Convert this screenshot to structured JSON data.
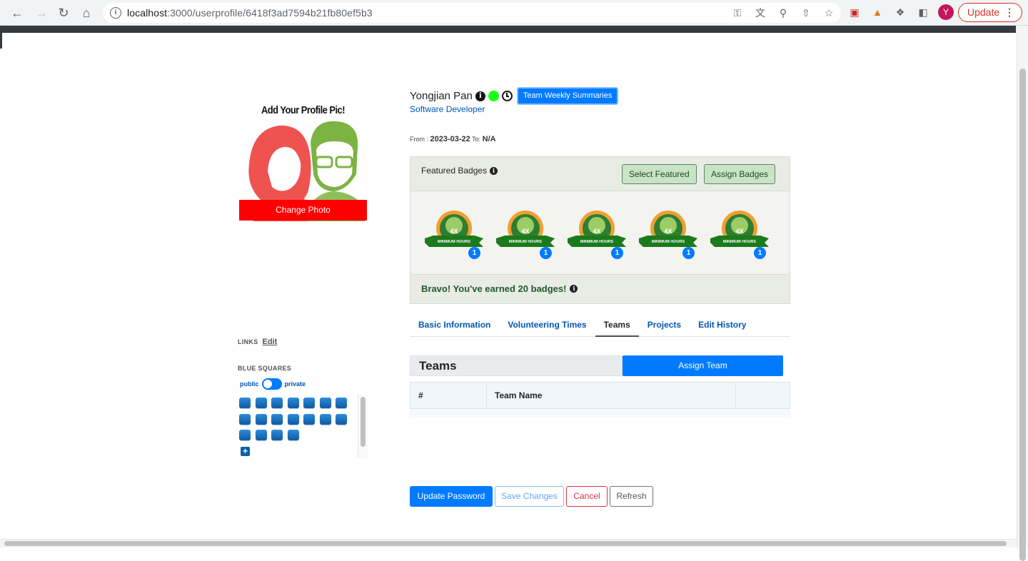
{
  "browser": {
    "url_host": "localhost",
    "url_path": ":3000/userprofile/6418f3ad7594b21fb80ef5b3",
    "avatar_letter": "Y",
    "update_label": "Update"
  },
  "profile": {
    "pic_title": "Add Your Profile Pic!",
    "change_photo_label": "Change Photo",
    "name": "Yongjian Pan",
    "team_weekly_summaries_label": "Team Weekly Summaries",
    "job_title": "Software Developer",
    "from_label": "From :",
    "from_date": "2023-03-22",
    "to_label": "To:",
    "to_date": "N/A",
    "status_color": "#1aff1a"
  },
  "badges": {
    "featured_label": "Featured Badges",
    "select_featured_label": "Select Featured",
    "assign_badges_label": "Assign Badges",
    "items": [
      {
        "text": "4X",
        "ribbon": "MINIMUM HOURS",
        "count": "1"
      },
      {
        "text": "4X",
        "ribbon": "MINIMUM HOURS",
        "count": "1"
      },
      {
        "text": "4X",
        "ribbon": "MINIMUM HOURS",
        "count": "1"
      },
      {
        "text": "4X",
        "ribbon": "MINIMUM HOURS",
        "count": "1"
      },
      {
        "text": "4X",
        "ribbon": "MINIMUM HOURS",
        "count": "1"
      }
    ],
    "earned_text": "Bravo! You've earned 20 badges!"
  },
  "tabs": [
    {
      "label": "Basic Information",
      "active": false
    },
    {
      "label": "Volunteering Times",
      "active": false
    },
    {
      "label": "Teams",
      "active": true
    },
    {
      "label": "Projects",
      "active": false
    },
    {
      "label": "Edit History",
      "active": false
    }
  ],
  "teams": {
    "heading": "Teams",
    "assign_label": "Assign Team",
    "columns": [
      "#",
      "Team Name",
      ""
    ]
  },
  "sidebar": {
    "links_label": "LINKS",
    "links_edit": "Edit",
    "blue_squares_label": "BLUE SQUARES",
    "public_label": "public",
    "private_label": "private",
    "square_count": 18,
    "add_label": "+"
  },
  "actions": {
    "update_password": "Update Password",
    "save_changes": "Save Changes",
    "cancel": "Cancel",
    "refresh": "Refresh"
  },
  "colors": {
    "primary": "#007bff",
    "danger": "#dc3545",
    "change_photo": "#ff0000",
    "badge_green": "#1d5a2c"
  }
}
